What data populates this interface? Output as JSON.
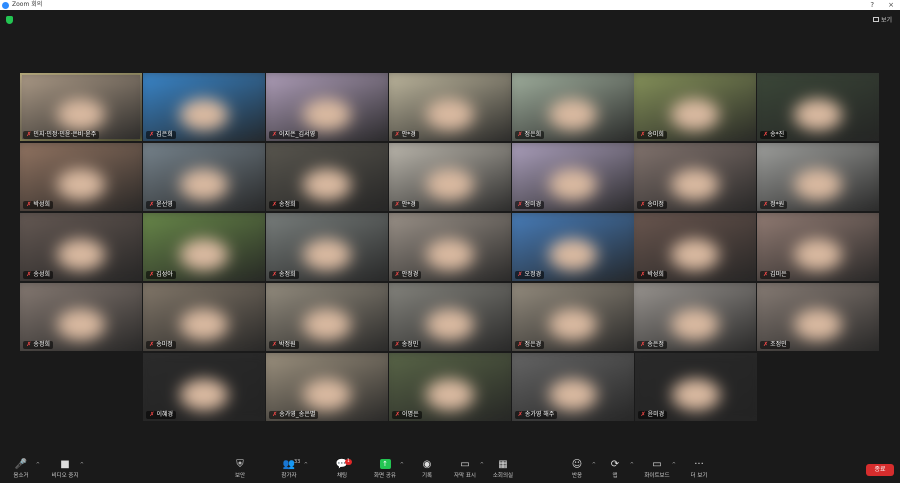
{
  "window": {
    "title": "Zoom 회의",
    "min": "?",
    "close": "×"
  },
  "topbar": {
    "view_label": "보기"
  },
  "tiles": {
    "row1": [
      {
        "name": "민지·민정·민윤·은비·윤주",
        "active": true,
        "bg": "#b7a48f"
      },
      {
        "name": "김은희",
        "bg": "#3b8dd6"
      },
      {
        "name": "이지은_김서영",
        "bg": "#b9a7c4"
      },
      {
        "name": "안*경",
        "bg": "#c9c1a6"
      },
      {
        "name": "정은희",
        "bg": "#a9b9a6"
      },
      {
        "name": "송미희",
        "bg": "#8d9a5e"
      },
      {
        "name": "송*진",
        "bg": "#3d4a3a"
      }
    ],
    "row2": [
      {
        "name": "박성희",
        "bg": "#9a7a66"
      },
      {
        "name": "윤선영",
        "bg": "#7d8b95"
      },
      {
        "name": "송정희",
        "bg": "#5d5a52"
      },
      {
        "name": "안*경",
        "bg": "#c8c3b8"
      },
      {
        "name": "정미경",
        "bg": "#b6a9c8"
      },
      {
        "name": "송미정",
        "bg": "#8a7a74"
      },
      {
        "name": "정*원",
        "bg": "#a8a9a6"
      }
    ],
    "row3": [
      {
        "name": "송성희",
        "bg": "#6a5d57"
      },
      {
        "name": "김성아",
        "bg": "#6d8f4c"
      },
      {
        "name": "송정희",
        "bg": "#7f8583"
      },
      {
        "name": "안정경",
        "bg": "#a49a90"
      },
      {
        "name": "오정경",
        "bg": "#4a83c4"
      },
      {
        "name": "박성희",
        "bg": "#6f5a52"
      },
      {
        "name": "김미은",
        "bg": "#9a8279"
      }
    ],
    "row4": [
      {
        "name": "송정희",
        "bg": "#8d8078"
      },
      {
        "name": "송미정",
        "bg": "#8a7e6f"
      },
      {
        "name": "박정원",
        "bg": "#9d9586"
      },
      {
        "name": "송정민",
        "bg": "#8c8b84"
      },
      {
        "name": "정은경",
        "bg": "#9d9485"
      },
      {
        "name": "송은정",
        "bg": "#a29d98"
      },
      {
        "name": "조정민",
        "bg": "#8f837b"
      }
    ],
    "row5": [
      {
        "name": "이혜경",
        "bg": "#2b2b2b"
      },
      {
        "name": "송가영_송은별",
        "bg": "#a59985"
      },
      {
        "name": "이명은",
        "bg": "#5d6a4a"
      },
      {
        "name": "송가영 해주",
        "bg": "#6a6a6a"
      },
      {
        "name": "윤미경",
        "bg": "#2a2a2a"
      }
    ]
  },
  "toolbar": {
    "mute": "음소거",
    "video": "비디오 중지",
    "security": "보안",
    "participants": "참가자",
    "participants_count": "33",
    "chat": "채팅",
    "chat_badge": "1",
    "share": "화면 공유",
    "record": "기록",
    "captions": "자막 표시",
    "rooms": "소회의실",
    "reactions": "반응",
    "apps": "앱",
    "whiteboard": "화이트보드",
    "more": "더 보기",
    "end": "종료"
  },
  "colors": {
    "accent": "#23c552",
    "active_outline": "#c9d44a",
    "end": "#d62d2d",
    "muted": "#ff4a4a"
  }
}
